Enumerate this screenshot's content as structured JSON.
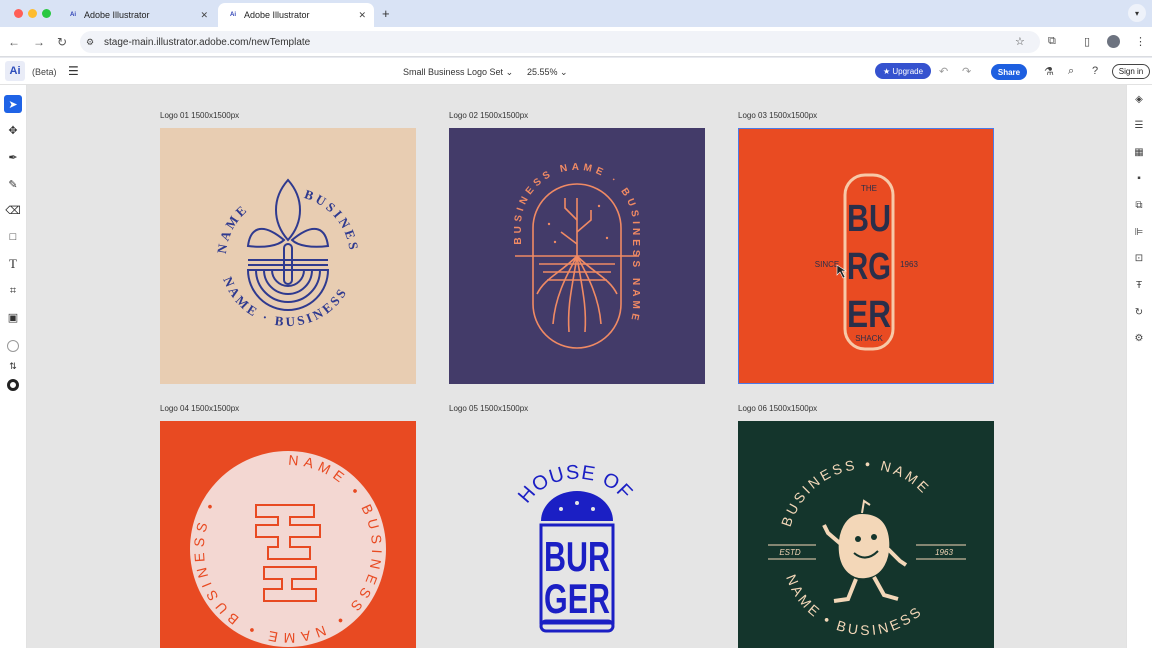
{
  "browser": {
    "tabs": [
      {
        "label": "Adobe Illustrator",
        "active": false
      },
      {
        "label": "Adobe Illustrator",
        "active": true
      }
    ],
    "url": "stage-main.illustrator.adobe.com/newTemplate"
  },
  "app": {
    "logo": "Ai",
    "beta_label": "(Beta)",
    "document_name": "Small Business Logo Set",
    "zoom": "25.55%",
    "upgrade_label": "Upgrade",
    "share_label": "Share",
    "signin_label": "Sign in"
  },
  "artboards": [
    {
      "label": "Logo 01 1500x1500px",
      "bg": "#e8cdb2"
    },
    {
      "label": "Logo 02 1500x1500px",
      "bg": "#433b69"
    },
    {
      "label": "Logo 03 1500x1500px",
      "bg": "#e94b22"
    },
    {
      "label": "Logo 04 1500x1500px",
      "bg": "#e84a22"
    },
    {
      "label": "Logo 05 1500x1500px",
      "bg": "#e5e5e5"
    },
    {
      "label": "Logo 06 1500x1500px",
      "bg": "#14352c"
    }
  ],
  "logos": {
    "logo1": {
      "top_text": "BUSINESS",
      "left_text": "NAME",
      "bottom_text": "NAME · BUSINESS"
    },
    "logo2": {
      "ring_text": "BUSINESS NAME · BUSINESS NAME"
    },
    "logo3": {
      "top": "THE",
      "line1": "BU",
      "line2": "RG",
      "line3": "ER",
      "left": "SINCE",
      "right": "1963",
      "bottom": "SHACK"
    },
    "logo4": {
      "ring_text": "NAME • BUSINESS • NAME • BUSINESS •"
    },
    "logo5": {
      "arc": "HOUSE OF",
      "line1": "BUR",
      "line2": "GER"
    },
    "logo6": {
      "top_text": "BUSINESS • NAME",
      "bottom_text": "NAME • BUSINESS",
      "left": "ESTD",
      "right": "1963"
    }
  },
  "colors": {
    "accent": "#1f63e6",
    "navy": "#2f3a8f",
    "peach": "#f08a64",
    "burger_dark": "#2a2f4a",
    "cobalt": "#1b1fc4",
    "cream": "#f3d7b8"
  }
}
